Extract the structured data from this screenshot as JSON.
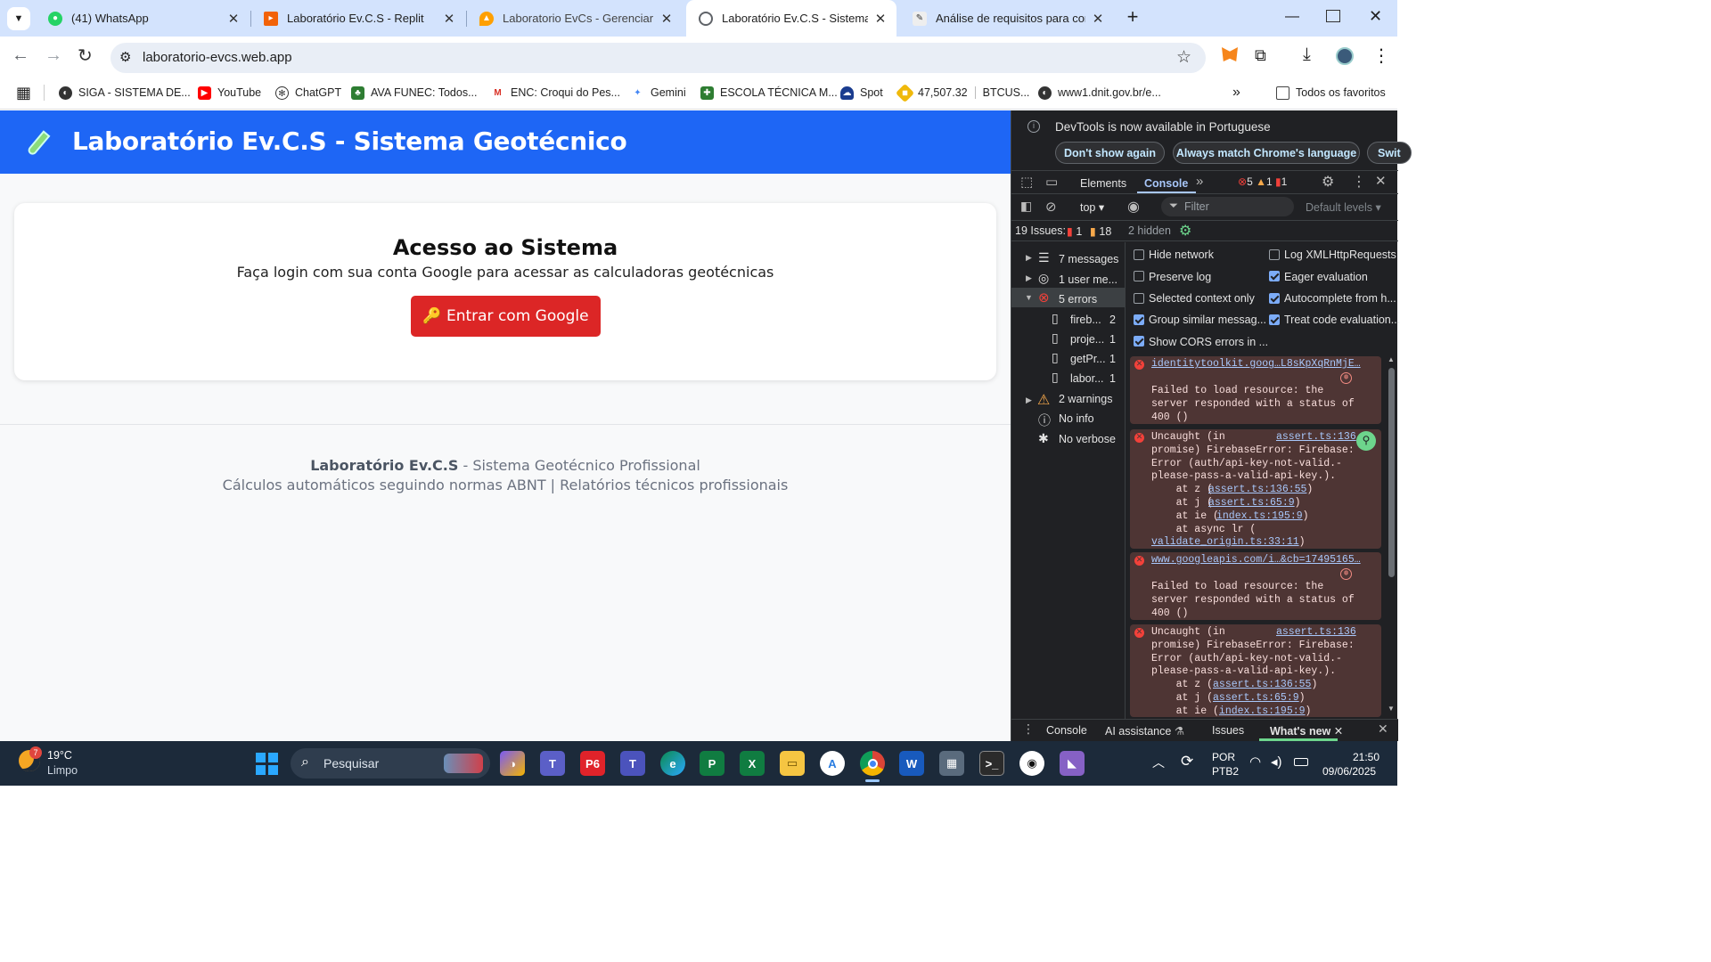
{
  "browser": {
    "tabs": [
      {
        "title": "(41) WhatsApp",
        "active": false
      },
      {
        "title": "Laboratório Ev.C.S - Replit",
        "active": false
      },
      {
        "title": "Laboratorio EvCs - Gerenciar sit",
        "active": false
      },
      {
        "title": "Laboratório Ev.C.S - Sistema Ge",
        "active": true
      },
      {
        "title": "Análise de requisitos para come",
        "active": false
      }
    ],
    "url": "laboratorio-evcs.web.app",
    "bookmarks": [
      "SIGA - SISTEMA DE...",
      "YouTube",
      "ChatGPT",
      "AVA FUNEC: Todos...",
      "ENC: Croqui do Pes...",
      "Gemini",
      "ESCOLA TÉCNICA M...",
      "Spot",
      "47,507.32",
      "BTCUS...",
      "www1.dnit.gov.br/e..."
    ],
    "all_bookmarks": "Todos os favoritos"
  },
  "page": {
    "header_title": "Laboratório Ev.C.S - Sistema Geotécnico",
    "card_title": "Acesso ao Sistema",
    "card_subtitle": "Faça login com sua conta Google para acessar as calculadoras geotécnicas",
    "login_button": "🔑 Entrar com Google",
    "footer_brand": "Laboratório Ev.C.S",
    "footer_line1_rest": " - Sistema Geotécnico Profissional",
    "footer_line2": "Cálculos automáticos seguindo normas ABNT | Relatórios técnicos profissionais"
  },
  "devtools": {
    "banner": "DevTools is now available in Portuguese",
    "dont_show": "Don't show again",
    "match_lang": "Always match Chrome's language",
    "switch": "Swit",
    "tabs": {
      "elements": "Elements",
      "console": "Console"
    },
    "counts": {
      "errors": "5",
      "warnings": "1",
      "issues": "1"
    },
    "context": "top",
    "filter_placeholder": "Filter",
    "levels": "Default levels",
    "issues_label": "19 Issues:",
    "issues_err": "1",
    "issues_warn": "18",
    "hidden": "2 hidden",
    "sidebar": {
      "messages": "7 messages",
      "user_messages": "1 user me...",
      "errors": "5 errors",
      "files": [
        {
          "name": "fireb...",
          "count": "2"
        },
        {
          "name": "proje...",
          "count": "1"
        },
        {
          "name": "getPr...",
          "count": "1"
        },
        {
          "name": "labor...",
          "count": "1"
        }
      ],
      "warnings": "2 warnings",
      "info": "No info",
      "verbose": "No verbose"
    },
    "settings": {
      "hide_network": "Hide network",
      "log_xhr": "Log XMLHttpRequests",
      "preserve_log": "Preserve log",
      "eager_eval": "Eager evaluation",
      "selected_context": "Selected context only",
      "autocomplete": "Autocomplete from h...",
      "group_similar": "Group similar messag...",
      "treat_code": "Treat code evaluation...",
      "show_cors": "Show CORS errors in ..."
    },
    "messages": [
      {
        "link": "identitytoolkit.goog…L8sKpXqRnMjE…",
        "text": "Failed to load resource: the\nserver responded with a status of\n400 ()"
      },
      {
        "text": "Uncaught (in\npromise) FirebaseError: Firebase:\nError (auth/api-key-not-valid.-\nplease-pass-a-valid-api-key.).\n    at z (\n    at j (\n    at ie (\n    at async lr (",
        "source": "assert.ts:136",
        "frames": [
          "assert.ts:136:55",
          "assert.ts:65:9",
          "index.ts:195:9",
          "validate_origin.ts:33:11"
        ]
      },
      {
        "link": "www.googleapis.com/i…&cb=17495165…",
        "text": "Failed to load resource: the\nserver responded with a status of\n400 ()"
      },
      {
        "text": "Uncaught (in\npromise) FirebaseError: Firebase:\nError (auth/api-key-not-valid.-\nplease-pass-a-valid-api-key.).",
        "source": "assert.ts:136",
        "frames": [
          "assert.ts:136:55",
          "assert.ts:65:9",
          "index.ts:195:9"
        ]
      }
    ],
    "drawer_tabs": [
      "Console",
      "AI assistance",
      "Issues",
      "What's new"
    ]
  },
  "taskbar": {
    "weather_temp": "19°C",
    "weather_desc": "Limpo",
    "weather_badge": "7",
    "search": "Pesquisar",
    "lang1": "POR",
    "lang2": "PTB2",
    "time": "21:50",
    "date": "09/06/2025"
  },
  "colors": {
    "header_blue": "#1e66f5",
    "button_red": "#dc2626",
    "tabstrip": "#d3e3fd",
    "devtools_bg": "#202124",
    "error_bg": "#4e3534"
  }
}
